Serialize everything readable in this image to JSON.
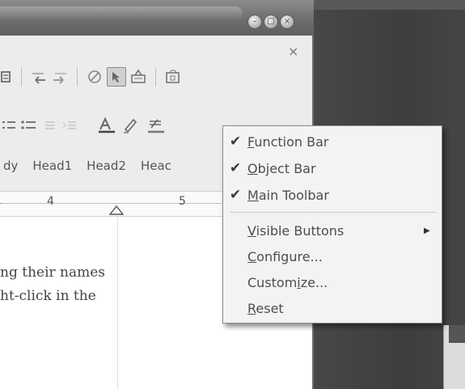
{
  "context_menu": {
    "items": [
      {
        "label": "Function Bar",
        "mnemonic": "F",
        "checked": true
      },
      {
        "label": "Object Bar",
        "mnemonic": "O",
        "checked": true
      },
      {
        "label": "Main Toolbar",
        "mnemonic": "M",
        "checked": true
      },
      {
        "label": "Visible Buttons",
        "mnemonic": "V",
        "checked": false,
        "submenu": true
      },
      {
        "label": "Configure...",
        "mnemonic": "C",
        "checked": false
      },
      {
        "label": "Customize...",
        "mnemonic": "i",
        "checked": false
      },
      {
        "label": "Reset",
        "mnemonic": "R",
        "checked": false
      }
    ],
    "check_glyph": "✔",
    "submenu_glyph": "▶"
  },
  "styles": [
    "dy",
    "Head1",
    "Head2",
    "Heac"
  ],
  "ruler": {
    "marks": [
      "4",
      "5"
    ]
  },
  "document": {
    "lines": [
      "ng their names",
      "ht-click in the"
    ]
  },
  "window": {
    "close_doc_glyph": "×"
  }
}
